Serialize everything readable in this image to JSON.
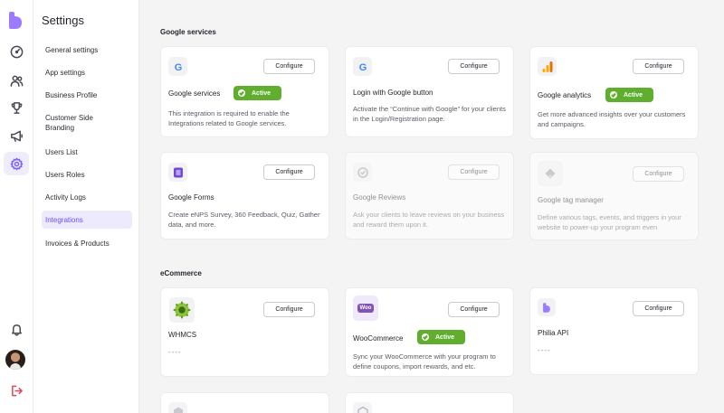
{
  "nav": {
    "title": "Settings",
    "items": [
      {
        "label": "General settings"
      },
      {
        "label": "App settings"
      },
      {
        "label": "Business Profile"
      },
      {
        "label": "Customer Side Branding"
      },
      {
        "label": "Users List"
      },
      {
        "label": "Users Roles"
      },
      {
        "label": "Activity Logs"
      },
      {
        "label": "Integrations",
        "active": true
      },
      {
        "label": "Invoices & Products"
      }
    ]
  },
  "rail": {
    "accent_color": "#7b61ff",
    "icons": [
      "logo-icon",
      "dashboard-icon",
      "users-icon",
      "trophy-icon",
      "megaphone-icon",
      "settings-icon",
      "bell-icon",
      "avatar",
      "logout-icon"
    ]
  },
  "sections": {
    "google": {
      "title": "Google services",
      "cards": [
        {
          "title": "Google services",
          "status": "Active",
          "button": "Configure",
          "desc": "This integration is required to enable the Integrations related to Google services."
        },
        {
          "title": "Login with Google button",
          "button": "Configure",
          "desc": "Activate the “Continue with Google” for your clients in the Login/Registration page."
        },
        {
          "title": "Google analytics",
          "status": "Active",
          "button": "Configure",
          "desc": "Get more advanced insights over your customers and campaigns."
        },
        {
          "title": "Google Forms",
          "button": "Configure",
          "desc": "Create eNPS Survey, 360 Feedback, Quiz, Gather data, and more."
        },
        {
          "title": "Google Reviews",
          "button": "Configure",
          "desc": "Ask your clients to leave reviews on your business and reward them upon it."
        },
        {
          "title": "Google tag manager",
          "button": "Configure",
          "desc": "Define various tags, events, and triggers in your website to power-up your program even"
        }
      ]
    },
    "ecommerce": {
      "title": "eCommerce",
      "cards": [
        {
          "title": "WHMCS",
          "button": "Configure",
          "desc": "----"
        },
        {
          "title": "WooCommerce",
          "status": "Active",
          "button": "Configure",
          "desc": "Sync your WooCommerce with your program to define coupons, import rewards, and etc.",
          "icon_text": "Woo"
        },
        {
          "title": "Philia API",
          "button": "Configure",
          "desc": "----"
        }
      ]
    }
  },
  "colors": {
    "active_badge": "#5fae2d",
    "accent": "#7b61ff"
  }
}
